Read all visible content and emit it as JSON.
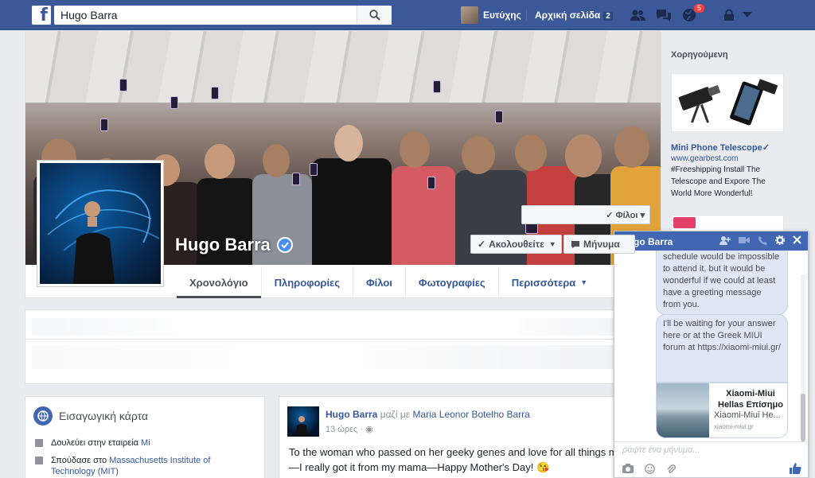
{
  "topbar": {
    "logo": "f",
    "search_value": "Hugo Barra",
    "user_name": "Ευτύχης",
    "home_label": "Αρχική σελίδα",
    "home_count": "2",
    "notifications_count": "5"
  },
  "profile": {
    "name": "Hugo Barra",
    "friends_button": "Φίλοι",
    "follow_button": "Ακολουθείτε",
    "message_button": "Μήνυμα"
  },
  "tabs": [
    {
      "label": "Χρονολόγιο"
    },
    {
      "label": "Πληροφορίες"
    },
    {
      "label": "Φίλοι"
    },
    {
      "label": "Φωτογραφίες"
    },
    {
      "label": "Περισσότερα"
    }
  ],
  "intro": {
    "title": "Εισαγωγική κάρτα",
    "work_prefix": "Δουλεύει στην εταιρεία ",
    "work_link": "Mi",
    "study_prefix": "Σπούδασε στο ",
    "study_link": "Massachusetts Institute of Technology (MIT)"
  },
  "post": {
    "author": "Hugo Barra",
    "with_label": "μαζί με",
    "tagged": "Maria Leonor Botelho Barra",
    "time": "13 ώρες",
    "text": "To the woman who passed on her geeky genes and love for all things me—I really got it from my mama—Happy Mother's Day! 😘"
  },
  "sidebar": {
    "sponsored_label": "Χορηγούμενη",
    "ad_title": "Mini Phone Telescope✓",
    "ad_url": "www.gearbest.com",
    "ad_text": "#Freeshipping Install The Telescope and Expore The World More Wonderful!"
  },
  "chat": {
    "title": "Hugo Barra",
    "message1": "schedule would be impossible to attend it, but it would be wonderful if we could at least have a greeting message from you.",
    "message2": "I'll be waiting for your answer here or at the Greek MIUI forum at https://xiaomi-miui.gr/",
    "link_title": "Xiaomi-Miui Hellas Επίσημο",
    "link_desc": "Xiaomi-Miui He...",
    "link_url": "xiaomi-miui.gr",
    "input_placeholder": "ράψτε ένα μήνυμα..."
  },
  "colors": {
    "brand": "#3b5998",
    "link": "#365899",
    "chat_header": "#4267b2",
    "bubble": "#dfe7f5"
  },
  "icons": [
    "search-icon",
    "friend-requests-icon",
    "messages-icon",
    "globe-icon",
    "lock-icon",
    "chevron-down-icon",
    "verified-icon",
    "check-icon",
    "message-icon",
    "add-person-icon",
    "video-icon",
    "phone-icon",
    "gear-icon",
    "close-icon",
    "camera-icon",
    "emoji-icon",
    "attach-icon",
    "like-icon",
    "briefcase-icon",
    "graduation-icon"
  ]
}
